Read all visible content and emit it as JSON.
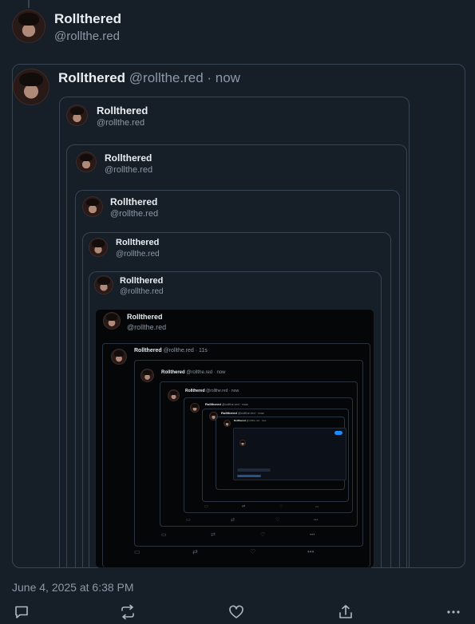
{
  "post": {
    "author_name": "Rollthered",
    "author_handle": "@rollthe.red",
    "timestamp": "June 4, 2025 at 6:38 PM"
  },
  "quote": {
    "author_name": "Rollthered",
    "author_handle": "@rollthe.red",
    "time": "· now"
  },
  "nested": [
    {
      "name": "Rollthered",
      "handle": "@rollthe.red"
    },
    {
      "name": "Rollthered",
      "handle": "@rollthe.red"
    },
    {
      "name": "Rollthered",
      "handle": "@rollthe.red"
    },
    {
      "name": "Rollthered",
      "handle": "@rollthe.red"
    },
    {
      "name": "Rollthered",
      "handle": "@rollthe.red"
    },
    {
      "name": "Rollthered",
      "handle": "@rollthe.red"
    }
  ],
  "deep": [
    {
      "name": "Rollthered",
      "meta": "@rollthe.red · 11s"
    },
    {
      "name": "Rollthered",
      "meta": "@rollthe.red · now"
    },
    {
      "name": "Rollthered",
      "meta": "@rollthe.red · now"
    },
    {
      "name": "Rollthered",
      "meta": "@rollthe.red · now"
    },
    {
      "name": "Rollthered",
      "meta": "@rollthe.red · now"
    },
    {
      "name": "Rollthered",
      "meta": "@rollthe.red · now"
    }
  ],
  "actions": {
    "reply_icon": "reply-icon",
    "repost_icon": "repost-icon",
    "like_icon": "heart-icon",
    "share_icon": "share-icon",
    "more_icon": "more-icon"
  },
  "colors": {
    "background": "#161e27",
    "border": "#384555",
    "muted_text": "#8d99a6",
    "accent": "#1d8cf8"
  }
}
